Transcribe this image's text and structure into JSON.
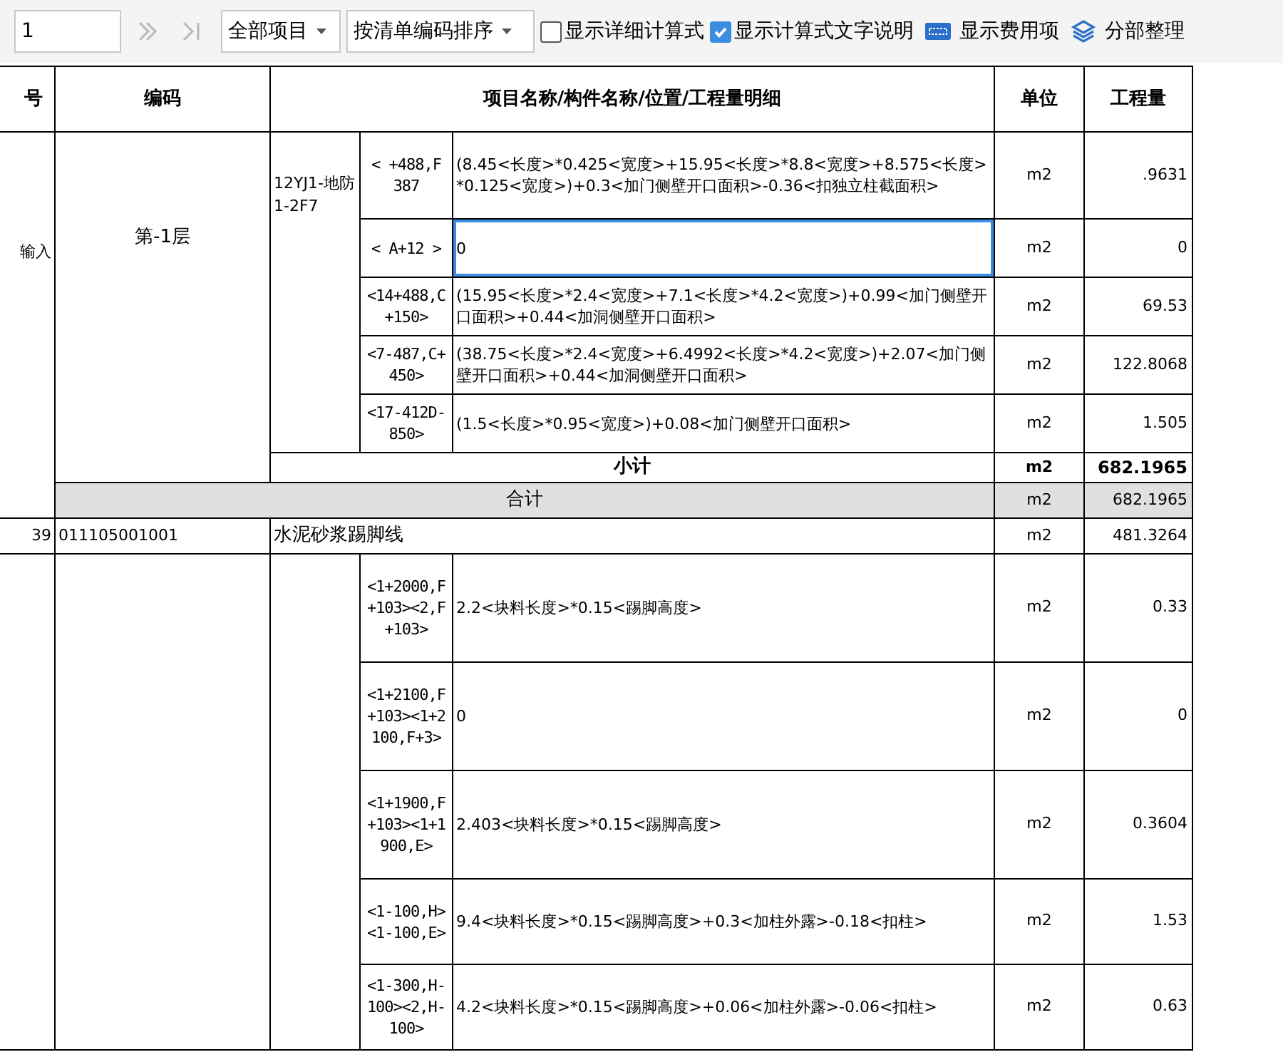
{
  "toolbar": {
    "page_input": "1",
    "dropdowns": [
      {
        "value": "全部项目"
      },
      {
        "value": "按清单编码排序"
      }
    ],
    "checkboxes": [
      {
        "label": "显示详细计算式",
        "checked": false
      },
      {
        "label": "显示计算式文字说明",
        "checked": true
      }
    ],
    "actions": [
      {
        "label": "显示费用项",
        "kind": "fees"
      },
      {
        "label": "分部整理",
        "kind": "layers"
      }
    ]
  },
  "table": {
    "columns": [
      "号",
      "编码",
      "项目名称/构件名称/位置/工程量明细",
      "单位",
      "工程量"
    ],
    "groups": [
      {
        "index": "输入",
        "code": "第-1层",
        "name": "12YJ1-地防1-2F7",
        "details": [
          {
            "location": "< +488,F 387",
            "formula": "(8.45<长度>*0.425<宽度>+15.95<长度>*8.8<宽度>+8.575<长度>*0.125<宽度>)+0.3<加门侧壁开口面积>-0.36<扣独立柱截面积>",
            "unit": "m2",
            "quantity": ".9631",
            "selected": false
          },
          {
            "location": "< A+12 >",
            "formula": "0",
            "unit": "m2",
            "quantity": "0",
            "selected": true
          },
          {
            "location": "<14+488,C+150>",
            "formula": "(15.95<长度>*2.4<宽度>+7.1<长度>*4.2<宽度>)+0.99<加门侧壁开口面积>+0.44<加洞侧壁开口面积>",
            "unit": "m2",
            "quantity": "69.53",
            "selected": false
          },
          {
            "location": "<7-487,C+450>",
            "formula": "(38.75<长度>*2.4<宽度>+6.4992<长度>*4.2<宽度>)+2.07<加门侧壁开口面积>+0.44<加洞侧壁开口面积>",
            "unit": "m2",
            "quantity": "122.8068",
            "selected": false
          },
          {
            "location": "<17-412D-850>",
            "formula": "(1.5<长度>*0.95<宽度>)+0.08<加门侧壁开口面积>",
            "unit": "m2",
            "quantity": "1.505",
            "selected": false
          }
        ],
        "subtotal": {
          "label": "小计",
          "unit": "m2",
          "quantity": "682.1965"
        }
      }
    ],
    "total": {
      "label": "合计",
      "unit": "m2",
      "quantity": "682.1965"
    },
    "item": {
      "index": "39",
      "code": "011105001001",
      "name": "水泥砂浆踢脚线",
      "unit": "m2",
      "quantity": "481.3264"
    },
    "item_details": [
      {
        "location": "<1+2000,F+103><2,F+103>",
        "formula": "2.2<块料长度>*0.15<踢脚高度>",
        "unit": "m2",
        "quantity": "0.33",
        "selected": false
      },
      {
        "location": "<1+2100,F+103><1+2100,F+3>",
        "formula": "0",
        "unit": "m2",
        "quantity": "0",
        "selected": false
      },
      {
        "location": "<1+1900,F+103><1+1900,E>",
        "formula": "2.403<块料长度>*0.15<踢脚高度>",
        "unit": "m2",
        "quantity": "0.3604",
        "selected": false
      },
      {
        "location": "<1-100,H><1-100,E>",
        "formula": "9.4<块料长度>*0.15<踢脚高度>+0.3<加柱外露>-0.18<扣柱>",
        "unit": "m2",
        "quantity": "1.53",
        "selected": false
      },
      {
        "location": "<1-300,H-100><2,H-100>",
        "formula": "4.2<块料长度>*0.15<踢脚高度>+0.06<加柱外露>-0.06<扣柱>",
        "unit": "m2",
        "quantity": "0.63",
        "selected": false
      }
    ]
  }
}
